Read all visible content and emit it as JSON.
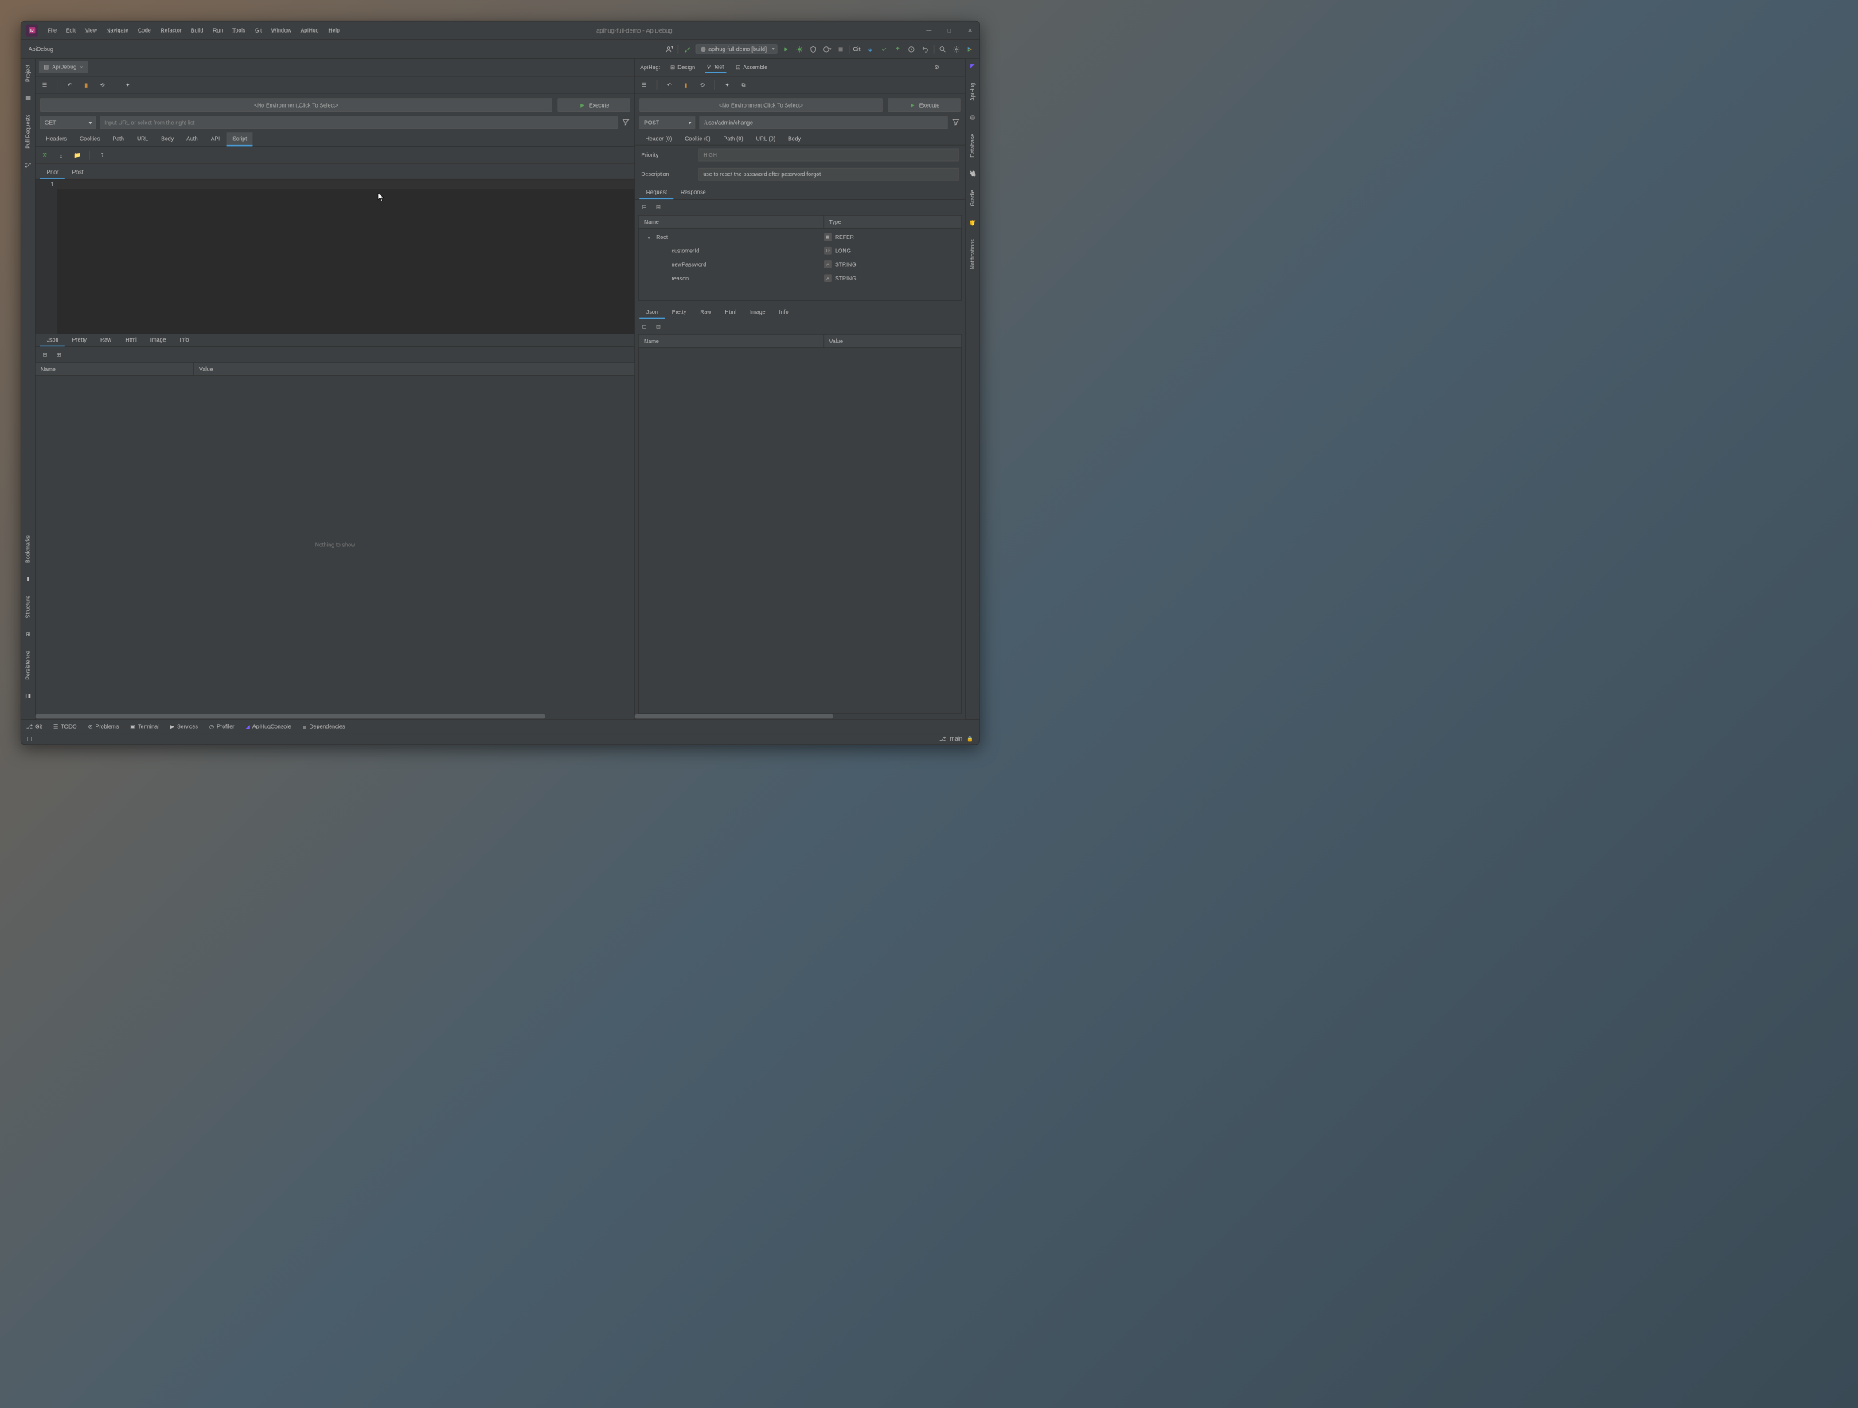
{
  "title": "apihug-full-demo - ApiDebug",
  "menus": [
    "File",
    "Edit",
    "View",
    "Navigate",
    "Code",
    "Refactor",
    "Build",
    "Run",
    "Tools",
    "Git",
    "Window",
    "ApiHug",
    "Help"
  ],
  "breadcrumb": "ApiDebug",
  "run_config": "apihug-full-demo [build]",
  "git_label": "Git:",
  "left_gutter": [
    "Project",
    "Pull Requests",
    "Bookmarks",
    "Structure",
    "Persistence"
  ],
  "right_gutter": [
    "ApiHug",
    "Database",
    "Gradle",
    "Notifications"
  ],
  "editor_tab": "ApiDebug",
  "left": {
    "env_placeholder": "<No Environment,Click To Select>",
    "execute": "Execute",
    "method": "GET",
    "url_placeholder": "Input URL or select from the right list",
    "req_tabs": [
      "Headers",
      "Cookies",
      "Path",
      "URL",
      "Body",
      "Auth",
      "API",
      "Script"
    ],
    "active_req_tab": "Script",
    "script_tabs": [
      "Prior",
      "Post"
    ],
    "active_script_tab": "Prior",
    "line_no": "1",
    "resp_tabs": [
      "Json",
      "Pretty",
      "Raw",
      "Html",
      "Image",
      "Info"
    ],
    "active_resp_tab": "Json",
    "table_cols": [
      "Name",
      "Value"
    ],
    "empty": "Nothing to show"
  },
  "right": {
    "hug_label": "ApiHug:",
    "hug_tabs": [
      "Design",
      "Test",
      "Assemble"
    ],
    "active_hug_tab": "Test",
    "env_placeholder": "<No Environment,Click To Select>",
    "execute": "Execute",
    "method": "POST",
    "url": "/user/admin/change",
    "param_tabs": [
      "Header (0)",
      "Cookie (0)",
      "Path (0)",
      "URL (0)",
      "Body"
    ],
    "priority_label": "Priority",
    "priority_value": "HIGH",
    "desc_label": "Description",
    "desc_value": "use to reset the password after password forgot",
    "rr_tabs": [
      "Request",
      "Response"
    ],
    "active_rr_tab": "Request",
    "tree_cols": [
      "Name",
      "Type"
    ],
    "tree": [
      {
        "indent": 0,
        "exp": true,
        "name": "Root",
        "type": "REFER",
        "icon": "grid"
      },
      {
        "indent": 1,
        "name": "customerId",
        "type": "LONG",
        "icon": "num"
      },
      {
        "indent": 1,
        "name": "newPassword",
        "type": "STRING",
        "icon": "A"
      },
      {
        "indent": 1,
        "name": "reason",
        "type": "STRING",
        "icon": "A"
      }
    ],
    "resp_tabs": [
      "Json",
      "Pretty",
      "Raw",
      "Html",
      "Image",
      "Info"
    ],
    "active_resp_tab": "Json",
    "table_cols": [
      "Name",
      "Value"
    ]
  },
  "status_items": [
    "Git",
    "TODO",
    "Problems",
    "Terminal",
    "Services",
    "Profiler",
    "ApiHugConsole",
    "Dependencies"
  ],
  "branch": "main"
}
